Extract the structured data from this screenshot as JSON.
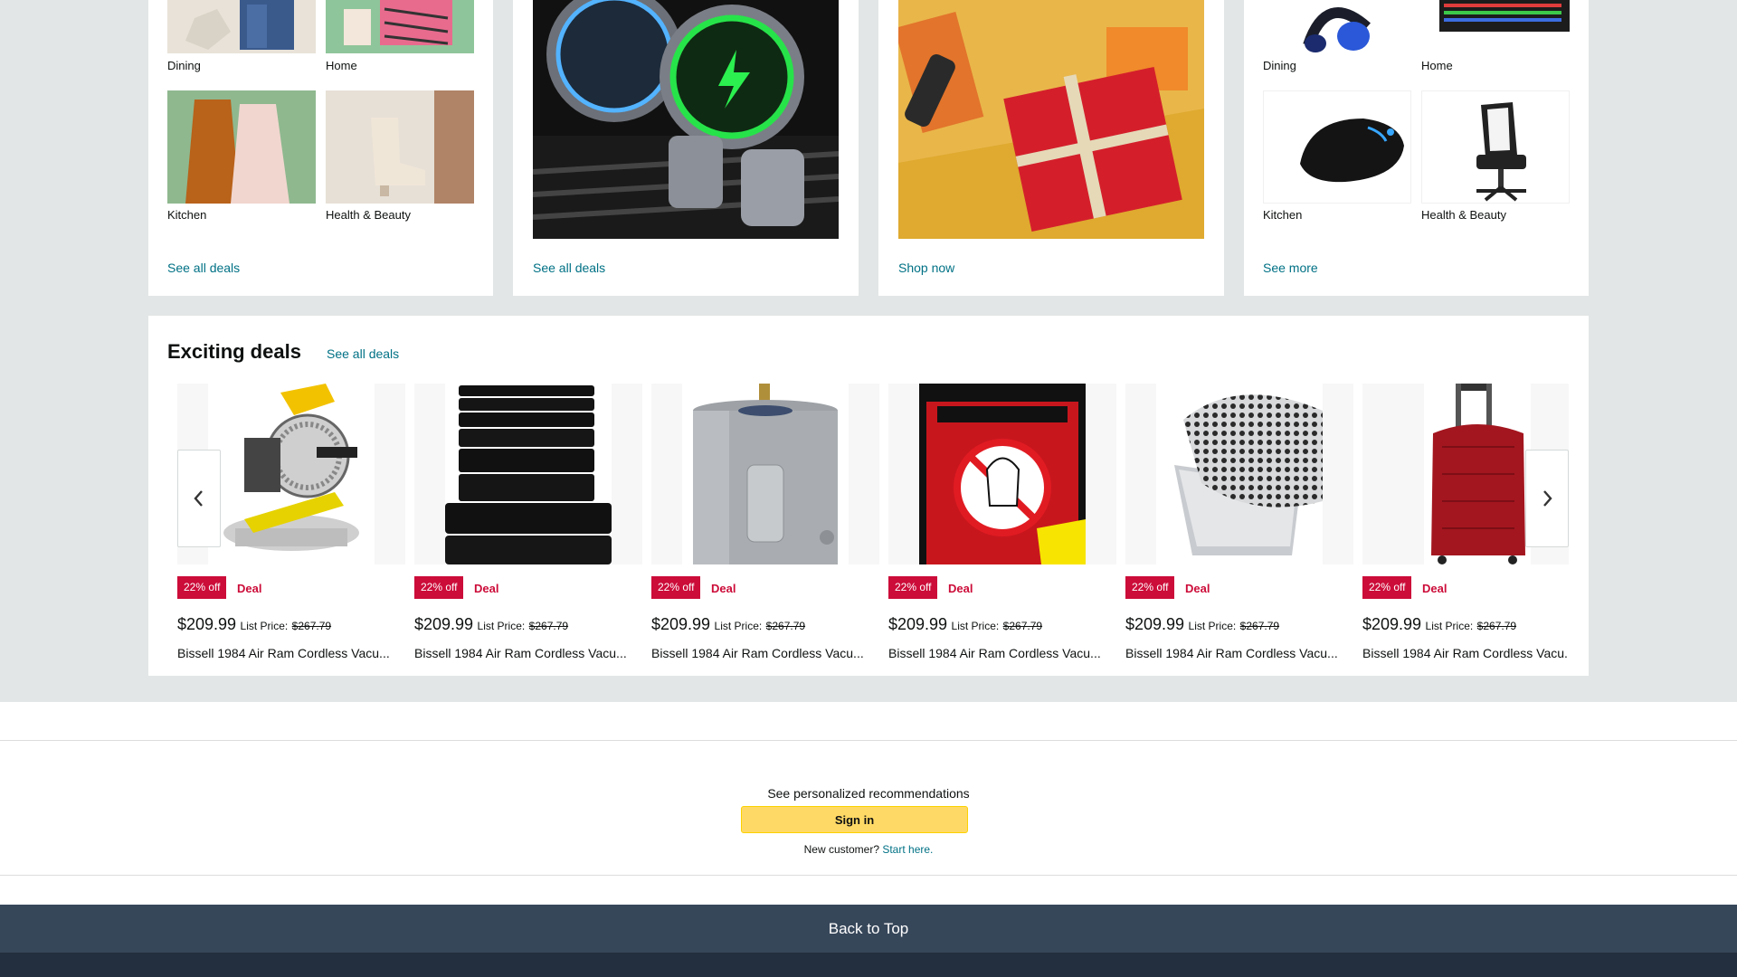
{
  "cards": [
    {
      "tiles": [
        {
          "label": "Dining"
        },
        {
          "label": "Home"
        },
        {
          "label": "Kitchen"
        },
        {
          "label": "Health & Beauty"
        }
      ],
      "link": "See all deals"
    },
    {
      "link": "See all deals"
    },
    {
      "link": "Shop now"
    },
    {
      "tiles": [
        {
          "label": "Dining"
        },
        {
          "label": "Home"
        },
        {
          "label": "Kitchen"
        },
        {
          "label": "Health & Beauty"
        }
      ],
      "link": "See more"
    }
  ],
  "deals": {
    "title": "Exciting deals",
    "see_all": "See all deals",
    "items": [
      {
        "badge": "22% off",
        "deal": "Deal",
        "price": "$209.99",
        "list_label": "List Price:",
        "list_price": "$267.79",
        "title": "Bissell 1984 Air Ram Cordless Vacu...",
        "image": "miter-saw"
      },
      {
        "badge": "22% off",
        "deal": "Deal",
        "price": "$209.99",
        "list_label": "List Price:",
        "list_price": "$267.79",
        "title": "Bissell 1984 Air Ram Cordless Vacu...",
        "image": "black-towels"
      },
      {
        "badge": "22% off",
        "deal": "Deal",
        "price": "$209.99",
        "list_label": "List Price:",
        "list_price": "$267.79",
        "title": "Bissell 1984 Air Ram Cordless Vacu...",
        "image": "water-heater"
      },
      {
        "badge": "22% off",
        "deal": "Deal",
        "price": "$209.99",
        "list_label": "List Price:",
        "list_price": "$267.79",
        "title": "Bissell 1984 Air Ram Cordless Vacu...",
        "image": "ghostbusters-bluray"
      },
      {
        "badge": "22% off",
        "deal": "Deal",
        "price": "$209.99",
        "list_label": "List Price:",
        "list_price": "$267.79",
        "title": "Bissell 1984 Air Ram Cordless Vacu...",
        "image": "grill-basket"
      },
      {
        "badge": "22% off",
        "deal": "Deal",
        "price": "$209.99",
        "list_label": "List Price:",
        "list_price": "$267.79",
        "title": "Bissell 1984 Air Ram Cordless Vacu...",
        "image": "red-luggage"
      }
    ]
  },
  "signin": {
    "reco_text": "See personalized recommendations",
    "button": "Sign in",
    "new_customer": "New customer?",
    "start_here": "Start here."
  },
  "footer": {
    "back_to_top": "Back to Top"
  },
  "colors": {
    "background": "#e3e6e6",
    "link": "#007185",
    "deal_red": "#cc0c39",
    "signin_yellow": "#ffd965",
    "back_top": "#37475a",
    "footer_dark": "#232f3e"
  }
}
